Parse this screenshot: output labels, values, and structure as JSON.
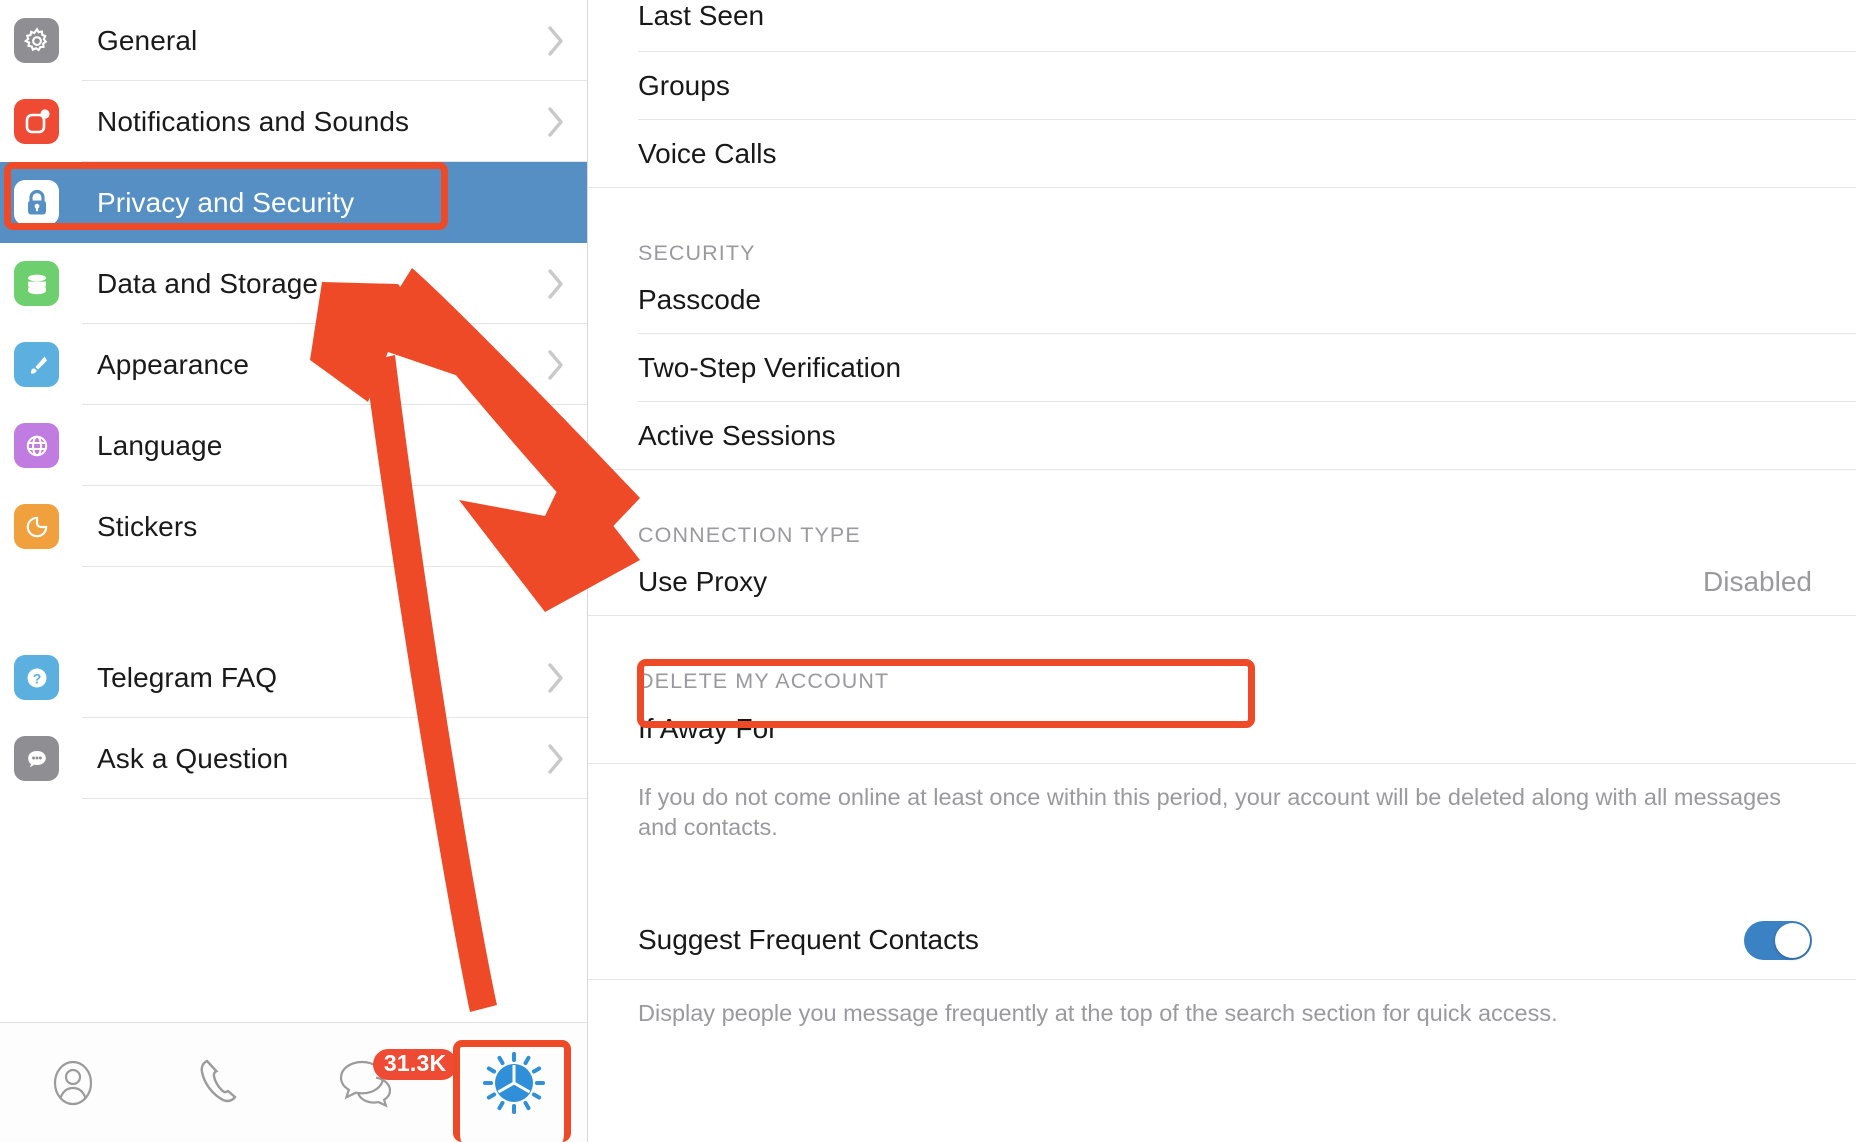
{
  "sidebar": {
    "items": [
      {
        "label": "General",
        "icon": "gear-icon",
        "color": "#8e8e93",
        "chevron": true,
        "selected": false
      },
      {
        "label": "Notifications and Sounds",
        "icon": "notification-bell-icon",
        "color": "#ef4a34",
        "chevron": true,
        "selected": false
      },
      {
        "label": "Privacy and Security",
        "icon": "lock-icon",
        "color": "#ffffff",
        "chevron": false,
        "selected": true
      },
      {
        "label": "Data and Storage",
        "icon": "database-icon",
        "color": "#6dcf6d",
        "chevron": true,
        "selected": false
      },
      {
        "label": "Appearance",
        "icon": "paintbrush-icon",
        "color": "#5cb0e0",
        "chevron": true,
        "selected": false
      },
      {
        "label": "Language",
        "icon": "globe-icon",
        "color": "#c07ce0",
        "chevron": true,
        "selected": false
      },
      {
        "label": "Stickers",
        "icon": "sticker-icon",
        "color": "#f0a03c",
        "chevron": true,
        "selected": false
      }
    ],
    "help_items": [
      {
        "label": "Telegram FAQ",
        "icon": "question-mark-icon",
        "color": "#5cb0e0",
        "chevron": true
      },
      {
        "label": "Ask a Question",
        "icon": "chat-bubble-icon",
        "color": "#8e8e93",
        "chevron": true
      }
    ],
    "tabbar": {
      "tabs": [
        {
          "name": "contacts-tab",
          "icon": "person-circle-icon"
        },
        {
          "name": "calls-tab",
          "icon": "phone-handset-icon"
        },
        {
          "name": "chats-tab",
          "icon": "chat-bubbles-icon",
          "badge": "31.3K"
        },
        {
          "name": "settings-tab",
          "icon": "telegram-settings-gear-icon"
        }
      ]
    }
  },
  "main": {
    "privacy_rows": [
      {
        "label": "Last Seen"
      },
      {
        "label": "Groups"
      },
      {
        "label": "Voice Calls"
      }
    ],
    "security": {
      "header": "SECURITY",
      "rows": [
        {
          "label": "Passcode"
        },
        {
          "label": "Two-Step Verification"
        },
        {
          "label": "Active Sessions"
        }
      ]
    },
    "connection": {
      "header": "CONNECTION TYPE",
      "rows": [
        {
          "label": "Use Proxy",
          "value": "Disabled"
        }
      ]
    },
    "delete_account": {
      "header": "DELETE MY ACCOUNT",
      "rows": [
        {
          "label": "If Away For"
        }
      ],
      "note": "If you do not come online at least once within this period, your account will be deleted along with all messages and contacts."
    },
    "suggest": {
      "label": "Suggest Frequent Contacts",
      "toggle_on": true,
      "note": "Display people you message frequently at the top of the search section for quick access."
    }
  },
  "annotations": {
    "accent_color": "#ef4a27",
    "highlight_color": "#558fc4"
  }
}
